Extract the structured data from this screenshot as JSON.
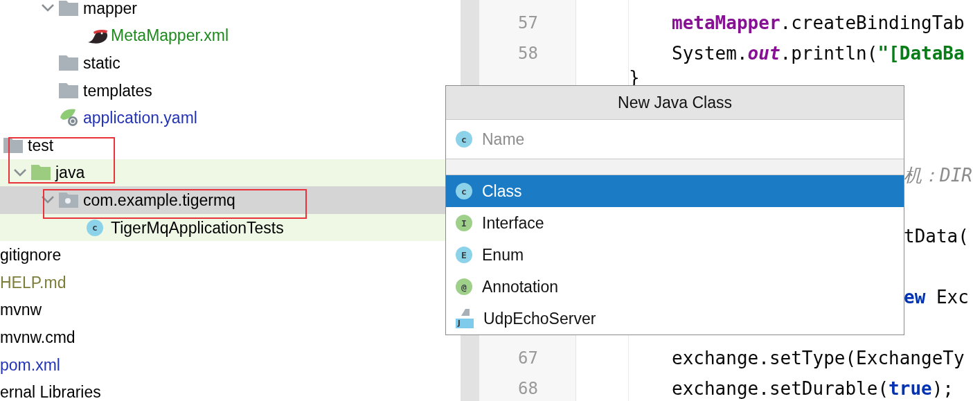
{
  "project_tree": [
    {
      "kind": "offscreen",
      "children": [
        {
          "kind": "offscreen",
          "children": [
            {
              "kind": "offscreen",
              "children": [
                {
                  "label": "mapper",
                  "kind": "folder",
                  "expanded": true,
                  "selected": false,
                  "highlighted": false,
                  "color": "#000000",
                  "children": [
                    {
                      "label": "MetaMapper.xml",
                      "kind": "bird-file",
                      "selected": false,
                      "highlighted": false,
                      "color": "#1e8a1e"
                    }
                  ]
                },
                {
                  "label": "static",
                  "kind": "folder",
                  "selected": false,
                  "highlighted": false,
                  "color": "#000000"
                },
                {
                  "label": "templates",
                  "kind": "folder",
                  "selected": false,
                  "highlighted": false,
                  "color": "#000000"
                },
                {
                  "label": "application.yaml",
                  "kind": "config-file",
                  "selected": false,
                  "highlighted": false,
                  "color": "#2233b8"
                }
              ]
            }
          ]
        },
        {
          "label": "test",
          "kind": "folder",
          "selected": false,
          "highlighted": false,
          "color": "#000000",
          "children": [
            {
              "label": "java",
              "kind": "test-folder",
              "expanded": true,
              "selected": false,
              "highlighted": true,
              "color": "#000000",
              "children": [
                {
                  "label": "com.example.tigermq",
                  "kind": "package",
                  "expanded": true,
                  "selected": true,
                  "highlighted": false,
                  "color": "#000000",
                  "children": [
                    {
                      "label": "TigerMqApplicationTests",
                      "kind": "class",
                      "icon_letter": "c",
                      "selected": false,
                      "highlighted": true,
                      "color": "#000000"
                    }
                  ]
                }
              ]
            }
          ]
        }
      ]
    },
    {
      "label": "gitignore",
      "kind": "file",
      "selected": false,
      "highlighted": false,
      "color": "#000000"
    },
    {
      "label": "HELP.md",
      "kind": "file",
      "selected": false,
      "highlighted": false,
      "color": "#7d7d3a"
    },
    {
      "label": "mvnw",
      "kind": "file",
      "selected": false,
      "highlighted": false,
      "color": "#000000"
    },
    {
      "label": "mvnw.cmd",
      "kind": "file",
      "selected": false,
      "highlighted": false,
      "color": "#000000"
    },
    {
      "label": "pom.xml",
      "kind": "file",
      "selected": false,
      "highlighted": false,
      "color": "#2233b8"
    },
    {
      "label": "ernal Libraries",
      "kind": "file",
      "selected": false,
      "highlighted": false,
      "color": "#000000"
    }
  ],
  "editor": {
    "lines": [
      {
        "kind": "code",
        "number": "57",
        "tokens": [
          {
            "text": "metaMapper",
            "kind": "field"
          },
          {
            "text": ".createBindingTab",
            "kind": "plain"
          }
        ]
      },
      {
        "kind": "code",
        "number": "58",
        "tokens": [
          {
            "text": "System.",
            "kind": "plain"
          },
          {
            "text": "out",
            "kind": "static"
          },
          {
            "text": ".println(",
            "kind": "plain"
          },
          {
            "text": "\"[DataBa",
            "kind": "string"
          }
        ]
      },
      {
        "kind": "brace",
        "tokens": [
          {
            "text": "}",
            "kind": "plain"
          }
        ]
      },
      {
        "kind": "hidden"
      },
      {
        "kind": "hidden"
      },
      {
        "kind": "partial",
        "tokens": [
          {
            "text": "机：DIR",
            "kind": "comment"
          }
        ]
      },
      {
        "kind": "hidden"
      },
      {
        "kind": "partial",
        "tokens": [
          {
            "text": "tData(",
            "kind": "plain"
          }
        ]
      },
      {
        "kind": "hidden"
      },
      {
        "kind": "partial",
        "tokens": [
          {
            "text": "ew",
            "kind": "keyword"
          },
          {
            "text": " Exc",
            "kind": "plain"
          }
        ]
      },
      {
        "kind": "hidden"
      },
      {
        "kind": "code",
        "number": "67",
        "tokens": [
          {
            "text": "exchange.setType(ExchangeTy",
            "kind": "plain"
          }
        ]
      },
      {
        "kind": "code",
        "number": "68",
        "tokens": [
          {
            "text": "exchange.setDurable(",
            "kind": "plain"
          },
          {
            "text": "true",
            "kind": "keyword"
          },
          {
            "text": ");",
            "kind": "plain"
          }
        ]
      }
    ]
  },
  "new_class_popup": {
    "title": "New Java Class",
    "name_field": {
      "placeholder": "Name",
      "icon_letter": "c"
    },
    "options": [
      {
        "label": "Class",
        "kind": "class",
        "icon_letter": "c",
        "selected": true
      },
      {
        "label": "Interface",
        "kind": "interface",
        "icon_letter": "I",
        "selected": false
      },
      {
        "label": "Enum",
        "kind": "enum",
        "icon_letter": "E",
        "selected": false
      },
      {
        "label": "Annotation",
        "kind": "annotation",
        "icon_letter": "@",
        "selected": false
      },
      {
        "label": "UdpEchoServer",
        "kind": "template",
        "icon_letter": "J",
        "selected": false
      }
    ]
  }
}
